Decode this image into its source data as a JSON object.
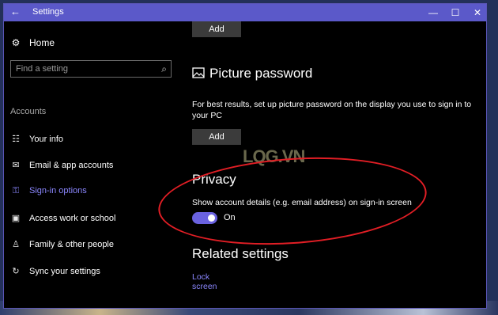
{
  "window": {
    "title": "Settings",
    "back_glyph": "←",
    "minimize": "—",
    "maximize": "☐",
    "close": "✕"
  },
  "sidebar": {
    "home_label": "Home",
    "home_icon": "gear-icon",
    "search_placeholder": "Find a setting",
    "section": "Accounts",
    "items": [
      {
        "label": "Your info",
        "icon": "contact-card-icon",
        "glyph": "☷"
      },
      {
        "label": "Email & app accounts",
        "icon": "mail-icon",
        "glyph": "✉"
      },
      {
        "label": "Sign-in options",
        "icon": "key-icon",
        "glyph": "⚿",
        "active": true
      },
      {
        "label": "Access work or school",
        "icon": "briefcase-icon",
        "glyph": "▣"
      },
      {
        "label": "Family & other people",
        "icon": "person-icon",
        "glyph": "♙"
      },
      {
        "label": "Sync your settings",
        "icon": "sync-icon",
        "glyph": "↻"
      }
    ]
  },
  "main": {
    "add_button_top": "Add",
    "picture_password": {
      "heading": "Picture password",
      "icon": "picture-icon",
      "description": "For best results, set up picture password on the display you use to sign in to your PC",
      "add_button": "Add"
    },
    "privacy": {
      "heading": "Privacy",
      "setting": "Show account details (e.g. email address) on sign-in screen",
      "toggle_state": "On"
    },
    "related": {
      "heading": "Related settings",
      "link": "Lock screen"
    }
  },
  "overlay": {
    "watermark": "LQG.VN",
    "annotation_color": "#e21e25"
  },
  "colors": {
    "accent": "#6a62e0",
    "titlebar": "#5b59c9",
    "link": "#8b87ff",
    "background": "#000000"
  }
}
